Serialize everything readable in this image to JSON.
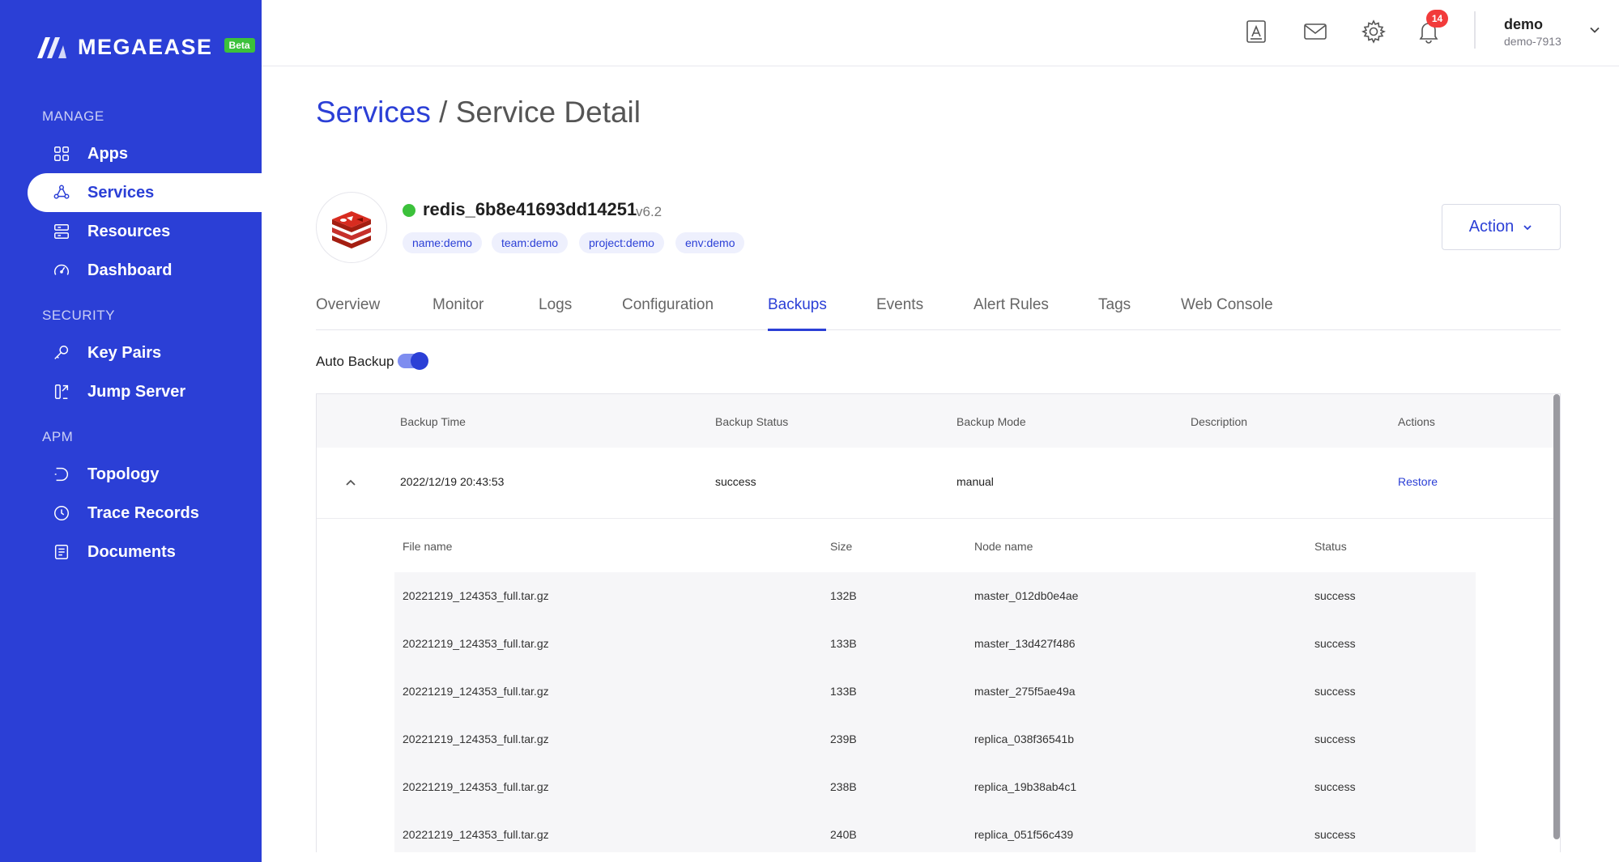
{
  "brand": {
    "name": "MEGAEASE",
    "badge": "Beta"
  },
  "sidebar": {
    "sections": [
      {
        "label": "MANAGE",
        "items": [
          {
            "label": "Apps",
            "icon": "grid-icon"
          },
          {
            "label": "Services",
            "icon": "services-icon",
            "active": true
          },
          {
            "label": "Resources",
            "icon": "server-icon"
          },
          {
            "label": "Dashboard",
            "icon": "gauge-icon"
          }
        ]
      },
      {
        "label": "SECURITY",
        "items": [
          {
            "label": "Key Pairs",
            "icon": "key-icon"
          },
          {
            "label": "Jump Server",
            "icon": "jump-server-icon"
          }
        ]
      },
      {
        "label": "APM",
        "items": [
          {
            "label": "Topology",
            "icon": "topology-icon"
          },
          {
            "label": "Trace Records",
            "icon": "clock-icon"
          },
          {
            "label": "Documents",
            "icon": "document-icon"
          }
        ]
      }
    ]
  },
  "header": {
    "notification_count": "14",
    "user": {
      "name": "demo",
      "id": "demo-7913"
    }
  },
  "breadcrumb": {
    "link": "Services",
    "separator": "/",
    "current": "Service Detail"
  },
  "service": {
    "name": "redis_6b8e41693dd14251",
    "version": "v6.2",
    "status_color": "#3cc13b",
    "tags": [
      "name:demo",
      "team:demo",
      "project:demo",
      "env:demo"
    ]
  },
  "action_label": "Action",
  "tabs": [
    "Overview",
    "Monitor",
    "Logs",
    "Configuration",
    "Backups",
    "Events",
    "Alert Rules",
    "Tags",
    "Web Console"
  ],
  "active_tab": "Backups",
  "auto_backup": {
    "label": "Auto Backup",
    "enabled": true
  },
  "backups_table": {
    "columns": [
      "Backup Time",
      "Backup Status",
      "Backup Mode",
      "Description",
      "Actions"
    ],
    "rows": [
      {
        "time": "2022/12/19 20:43:53",
        "status": "success",
        "mode": "manual",
        "description": "",
        "action": "Restore"
      }
    ]
  },
  "files_table": {
    "columns": [
      "File name",
      "Size",
      "Node name",
      "Status"
    ],
    "rows": [
      {
        "file": "20221219_124353_full.tar.gz",
        "size": "132B",
        "node": "master_012db0e4ae",
        "status": "success"
      },
      {
        "file": "20221219_124353_full.tar.gz",
        "size": "133B",
        "node": "master_13d427f486",
        "status": "success"
      },
      {
        "file": "20221219_124353_full.tar.gz",
        "size": "133B",
        "node": "master_275f5ae49a",
        "status": "success"
      },
      {
        "file": "20221219_124353_full.tar.gz",
        "size": "239B",
        "node": "replica_038f36541b",
        "status": "success"
      },
      {
        "file": "20221219_124353_full.tar.gz",
        "size": "238B",
        "node": "replica_19b38ab4c1",
        "status": "success"
      },
      {
        "file": "20221219_124353_full.tar.gz",
        "size": "240B",
        "node": "replica_051f56c439",
        "status": "success"
      }
    ]
  }
}
